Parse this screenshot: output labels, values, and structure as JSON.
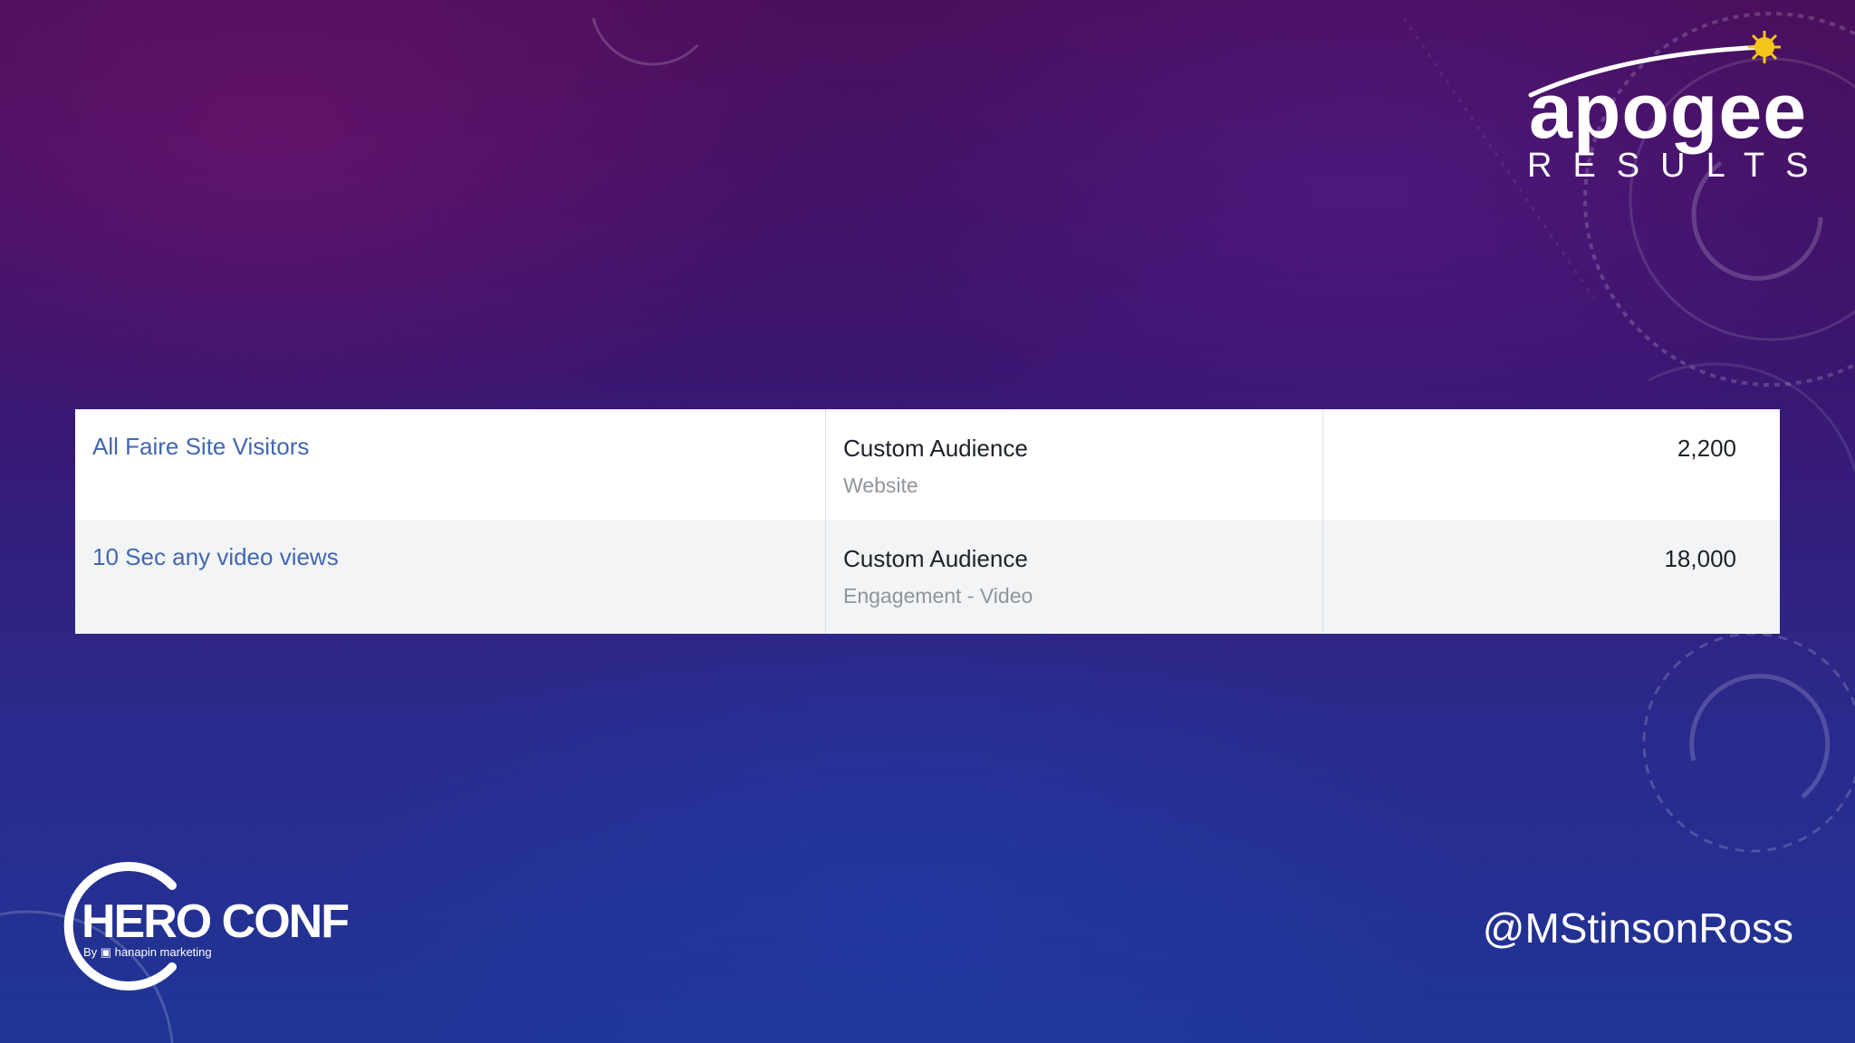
{
  "audiences": [
    {
      "name": "All Faire Site Visitors",
      "type": "Custom Audience",
      "subtype": "Website",
      "size": "2,200"
    },
    {
      "name": "10 Sec any video views",
      "type": "Custom Audience",
      "subtype": "Engagement - Video",
      "size": "18,000"
    }
  ],
  "logos": {
    "apogee_word": "apogee",
    "apogee_sub": "RESULTS",
    "hero_title": "HERO CONF",
    "hero_by": "By ▣ hanapin marketing"
  },
  "handle": "@MStinsonRoss",
  "colors": {
    "link": "#4267b2",
    "text": "#1d2129",
    "subtext": "#90949c",
    "accent_sun": "#f5c518"
  }
}
